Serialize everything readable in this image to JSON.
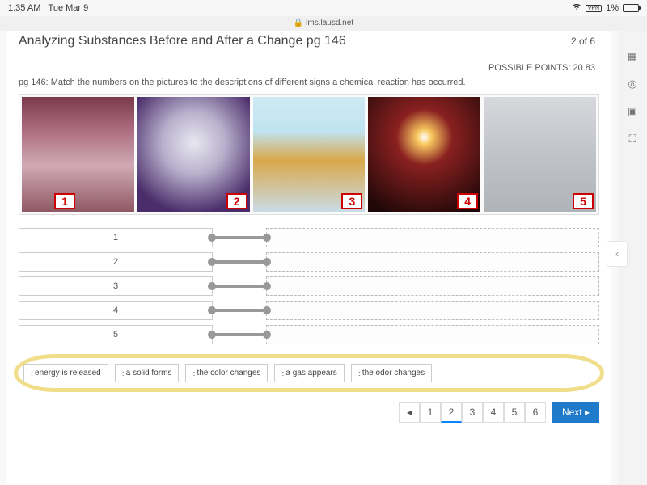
{
  "status": {
    "time": "1:35 AM",
    "date": "Tue Mar 9",
    "vpn": "VPN",
    "battery": "1%"
  },
  "url": {
    "domain": "lms.lausd.net"
  },
  "header": {
    "title": "Analyzing Substances Before and After a Change pg 146",
    "counter": "2 of 6"
  },
  "points_label": "POSSIBLE POINTS: 20.83",
  "prompt": "pg 146: Match the numbers on the pictures to the descriptions of different signs a chemical reaction has occurred.",
  "images": [
    {
      "num": "1"
    },
    {
      "num": "2"
    },
    {
      "num": "3"
    },
    {
      "num": "4"
    },
    {
      "num": "5"
    }
  ],
  "slots": [
    {
      "label": "1"
    },
    {
      "label": "2"
    },
    {
      "label": "3"
    },
    {
      "label": "4"
    },
    {
      "label": "5"
    }
  ],
  "choices": [
    {
      "text": "energy is released"
    },
    {
      "text": "a solid forms"
    },
    {
      "text": "the color changes"
    },
    {
      "text": "a gas appears"
    },
    {
      "text": "the odor changes"
    }
  ],
  "pager": {
    "pages": [
      "1",
      "2",
      "3",
      "4",
      "5",
      "6"
    ],
    "active": 1,
    "prev": "◂",
    "next": "Next ▸"
  }
}
